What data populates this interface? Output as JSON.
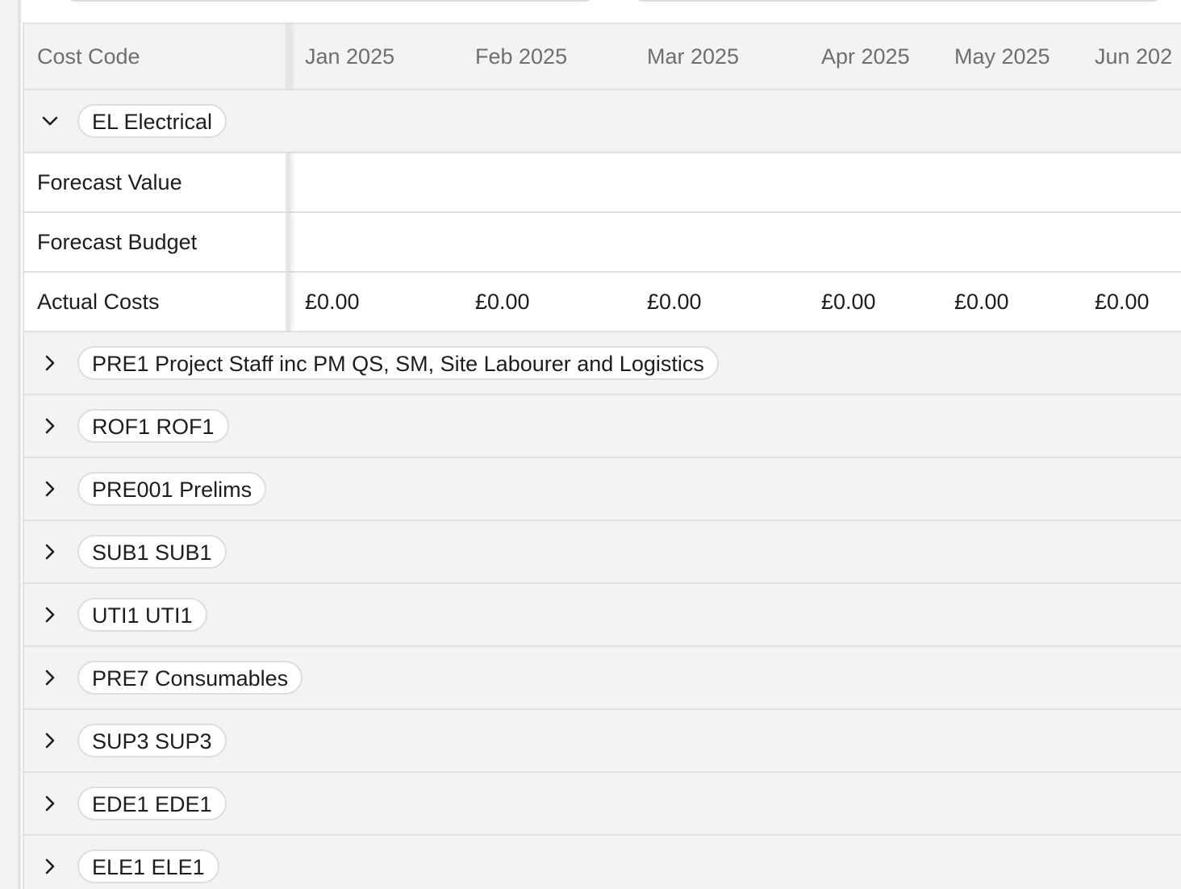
{
  "table": {
    "header": {
      "cost_code": "Cost Code",
      "months": [
        "Jan 2025",
        "Feb 2025",
        "Mar 2025",
        "Apr 2025",
        "May 2025",
        "Jun 202"
      ]
    },
    "expanded_group": {
      "label": "EL Electrical",
      "expanded": true,
      "rows": [
        {
          "label": "Forecast Value",
          "values": [
            "",
            "",
            "",
            "",
            "",
            ""
          ]
        },
        {
          "label": "Forecast Budget",
          "values": [
            "",
            "",
            "",
            "",
            "",
            ""
          ]
        },
        {
          "label": "Actual Costs",
          "values": [
            "£0.00",
            "£0.00",
            "£0.00",
            "£0.00",
            "£0.00",
            "£0.00"
          ]
        }
      ]
    },
    "collapsed_groups": [
      {
        "label": "PRE1 Project Staff inc PM QS, SM, Site Labourer and Logistics"
      },
      {
        "label": "ROF1 ROF1"
      },
      {
        "label": "PRE001 Prelims"
      },
      {
        "label": "SUB1 SUB1"
      },
      {
        "label": "UTI1 UTI1"
      },
      {
        "label": "PRE7 Consumables"
      },
      {
        "label": "SUP3 SUP3"
      },
      {
        "label": "EDE1 EDE1"
      },
      {
        "label": "ELE1 ELE1"
      }
    ]
  },
  "icons": {
    "expanded": "chevron-down-icon",
    "collapsed": "chevron-right-icon"
  }
}
